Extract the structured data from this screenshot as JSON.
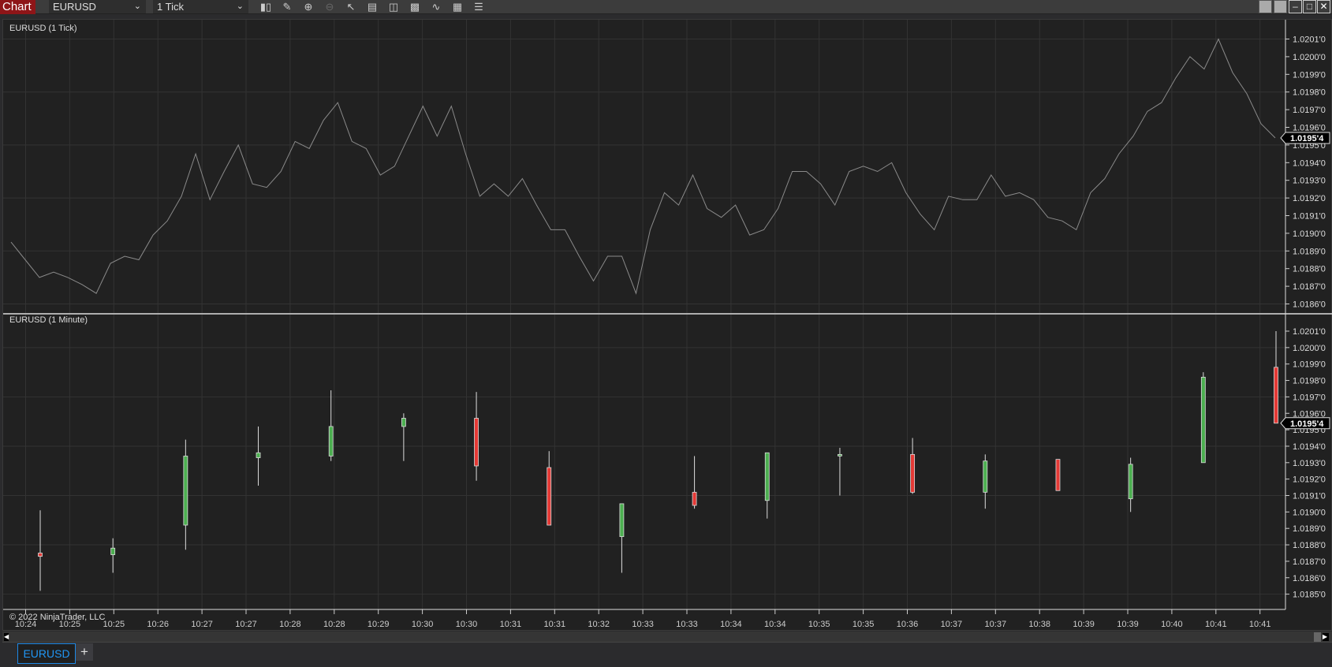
{
  "toolbar": {
    "chart_label": "Chart",
    "instrument": "EURUSD",
    "interval": "1 Tick",
    "icons": [
      "bar-type-icon",
      "drawing-tool-icon",
      "zoom-in-icon",
      "zoom-out-icon",
      "pointer-icon",
      "data-box-icon",
      "chart-trader-icon",
      "properties-icon",
      "strategies-icon",
      "indicators-icon",
      "objects-list-icon"
    ]
  },
  "window": {
    "icons": [
      "window-group-icon",
      "window-link-icon",
      "minimize-icon",
      "maximize-icon",
      "close-icon"
    ]
  },
  "top_pane": {
    "title": "EURUSD (1 Tick)",
    "last_price": "1.0195'4"
  },
  "bottom_pane": {
    "title": "EURUSD (1 Minute)",
    "last_price": "1.0195'4"
  },
  "copyright": "© 2022 NinjaTrader, LLC",
  "tabs": [
    {
      "label": "EURUSD",
      "active": true
    }
  ],
  "add_tab": "+",
  "colors": {
    "up": "#4caf50",
    "down": "#e53935",
    "background": "#212121",
    "grid": "#333333",
    "line": "#8a8a8a",
    "brand": "#8e1518",
    "tab_active": "#2196f3"
  },
  "chart_data": [
    {
      "type": "line",
      "title": "EURUSD (1 Tick)",
      "ylim": [
        1.01855,
        1.02015
      ],
      "yticks": [
        "1.0201'0",
        "1.0200'0",
        "1.0199'0",
        "1.0198'0",
        "1.0197'0",
        "1.0196'0",
        "1.0195'0",
        "1.0194'0",
        "1.0193'0",
        "1.0192'0",
        "1.0191'0",
        "1.0190'0",
        "1.0189'0",
        "1.0188'0",
        "1.0187'0",
        "1.0186'0"
      ],
      "values": [
        1.01895,
        1.01885,
        1.01875,
        1.01878,
        1.01875,
        1.01871,
        1.01866,
        1.01883,
        1.01887,
        1.01885,
        1.01899,
        1.01907,
        1.01921,
        1.01945,
        1.01919,
        1.01935,
        1.0195,
        1.01928,
        1.01926,
        1.01935,
        1.01952,
        1.01948,
        1.01964,
        1.01974,
        1.01952,
        1.01948,
        1.01933,
        1.01938,
        1.01955,
        1.01972,
        1.01955,
        1.01972,
        1.01945,
        1.01921,
        1.01928,
        1.01921,
        1.01931,
        1.01916,
        1.01902,
        1.01902,
        1.01887,
        1.01873,
        1.01887,
        1.01887,
        1.01866,
        1.01902,
        1.01923,
        1.01916,
        1.01933,
        1.01914,
        1.01909,
        1.01916,
        1.01899,
        1.01902,
        1.01914,
        1.01935,
        1.01935,
        1.01928,
        1.01916,
        1.01935,
        1.01938,
        1.01935,
        1.0194,
        1.01923,
        1.01911,
        1.01902,
        1.01921,
        1.01919,
        1.01919,
        1.01933,
        1.01921,
        1.01923,
        1.01919,
        1.01909,
        1.01907,
        1.01902,
        1.01923,
        1.01931,
        1.01945,
        1.01955,
        1.01969,
        1.01974,
        1.01988,
        1.02,
        1.01993,
        1.0201,
        1.01991,
        1.01979,
        1.01962,
        1.01954
      ]
    },
    {
      "type": "candlestick",
      "title": "EURUSD (1 Minute)",
      "ylim": [
        1.0184,
        1.02025
      ],
      "yticks": [
        "1.0201'0",
        "1.0200'0",
        "1.0199'0",
        "1.0198'0",
        "1.0197'0",
        "1.0196'0",
        "1.0195'0",
        "1.0194'0",
        "1.0193'0",
        "1.0192'0",
        "1.0191'0",
        "1.0190'0",
        "1.0189'0",
        "1.0188'0",
        "1.0187'0",
        "1.0186'0",
        "1.0185'0"
      ],
      "xticks": [
        "10:24",
        "10:25",
        "10:25",
        "10:26",
        "10:27",
        "10:27",
        "10:28",
        "10:28",
        "10:29",
        "10:30",
        "10:30",
        "10:31",
        "10:31",
        "10:32",
        "10:33",
        "10:33",
        "10:34",
        "10:34",
        "10:35",
        "10:35",
        "10:36",
        "10:37",
        "10:37",
        "10:38",
        "10:39",
        "10:39",
        "10:40",
        "10:41",
        "10:41"
      ],
      "candles": [
        {
          "o": 1.01875,
          "h": 1.01901,
          "l": 1.01852,
          "c": 1.01873
        },
        {
          "o": 1.01874,
          "h": 1.01884,
          "l": 1.01863,
          "c": 1.01878
        },
        {
          "o": 1.01892,
          "h": 1.01944,
          "l": 1.01877,
          "c": 1.01934
        },
        {
          "o": 1.01933,
          "h": 1.01952,
          "l": 1.01916,
          "c": 1.01936
        },
        {
          "o": 1.01934,
          "h": 1.01974,
          "l": 1.01931,
          "c": 1.01952
        },
        {
          "o": 1.01952,
          "h": 1.0196,
          "l": 1.01931,
          "c": 1.01957
        },
        {
          "o": 1.01957,
          "h": 1.01973,
          "l": 1.01919,
          "c": 1.01928
        },
        {
          "o": 1.01927,
          "h": 1.01937,
          "l": 1.01892,
          "c": 1.01892
        },
        {
          "o": 1.01885,
          "h": 1.01905,
          "l": 1.01863,
          "c": 1.01905
        },
        {
          "o": 1.01912,
          "h": 1.01934,
          "l": 1.01902,
          "c": 1.01904
        },
        {
          "o": 1.01907,
          "h": 1.01936,
          "l": 1.01896,
          "c": 1.01936
        },
        {
          "o": 1.01935,
          "h": 1.01939,
          "l": 1.0191,
          "c": 1.01935
        },
        {
          "o": 1.01935,
          "h": 1.01945,
          "l": 1.01911,
          "c": 1.01912
        },
        {
          "o": 1.01912,
          "h": 1.01935,
          "l": 1.01902,
          "c": 1.01931
        },
        {
          "o": 1.01932,
          "h": 1.01932,
          "l": 1.01913,
          "c": 1.01913
        },
        {
          "o": 1.01908,
          "h": 1.01933,
          "l": 1.019,
          "c": 1.01929
        },
        {
          "o": 1.0193,
          "h": 1.01985,
          "l": 1.0193,
          "c": 1.01982
        },
        {
          "o": 1.01988,
          "h": 1.0201,
          "l": 1.01954,
          "c": 1.01954
        }
      ]
    }
  ]
}
